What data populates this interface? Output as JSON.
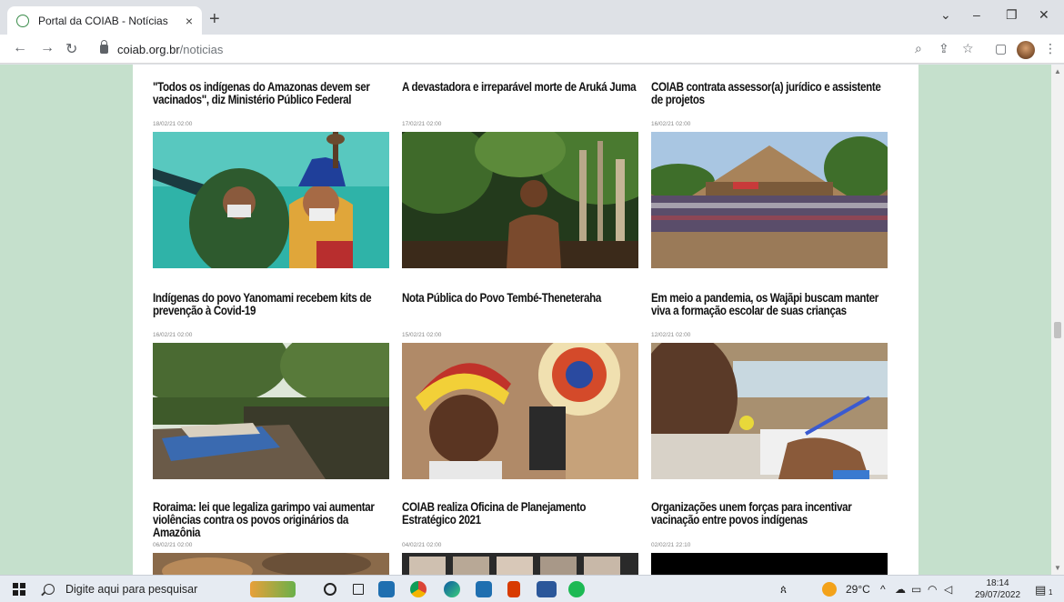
{
  "browser": {
    "tab_title": "Portal da COIAB - Notícias",
    "tab_close": "×",
    "new_tab": "+",
    "url_host": "coiab.org.br",
    "url_path": "/noticias"
  },
  "articles": [
    {
      "title": "\"Todos os indígenas do Amazonas devem ser vacinados\", diz Ministério Público Federal",
      "date": "18/02/21   02:00"
    },
    {
      "title": "A devastadora e irreparável morte de Aruká Juma",
      "date": "17/02/21   02:00"
    },
    {
      "title": "COIAB contrata assessor(a) jurídico e assistente de projetos",
      "date": "16/02/21   02:00"
    },
    {
      "title": "Indígenas do povo Yanomami recebem kits de prevenção à Covid-19",
      "date": "16/02/21   02:00"
    },
    {
      "title": "Nota Pública do Povo Tembé-Theneteraha",
      "date": "15/02/21   02:00"
    },
    {
      "title": "Em meio a pandemia, os Wajãpi buscam manter viva a formação escolar de suas crianças",
      "date": "12/02/21   02:00"
    },
    {
      "title": "Roraima: lei que legaliza garimpo vai aumentar violências contra os povos originários da Amazônia",
      "date": "06/02/21   02:00"
    },
    {
      "title": "COIAB realiza Oficina de Planejamento Estratégico 2021",
      "date": "04/02/21   02:00"
    },
    {
      "title": "Organizações unem forças para incentivar vacinação entre povos indígenas",
      "date": "02/02/21   22:10"
    }
  ],
  "taskbar": {
    "search_placeholder": "Digite aqui para pesquisar",
    "weather": "29°C",
    "time": "18:14",
    "date": "29/07/2022",
    "notification_count": "1"
  },
  "colors": {
    "page_background": "#c5e0cc",
    "content_background": "#ffffff"
  }
}
